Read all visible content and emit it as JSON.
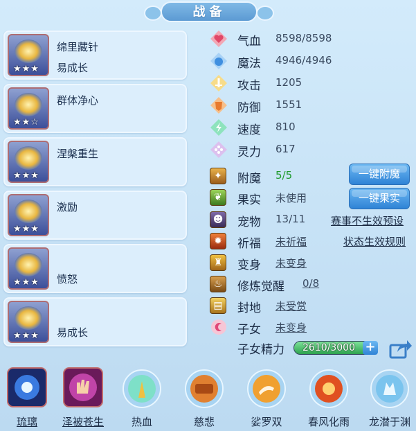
{
  "title": "战备",
  "cards": [
    {
      "name": "绵里藏针",
      "sub": "易成长",
      "stars": "★★★"
    },
    {
      "name": "群体净心",
      "sub": "",
      "stars": "★★☆"
    },
    {
      "name": "涅槃重生",
      "sub": "",
      "stars": "★★★"
    },
    {
      "name": "激励",
      "sub": "",
      "stars": "★★★"
    },
    {
      "name": "",
      "sub": "愤怒",
      "stars": "★★★"
    },
    {
      "name": "",
      "sub": "易成长",
      "stars": "★★★"
    }
  ],
  "stats": [
    {
      "label": "气血",
      "value": "8598/8598",
      "icon": "heart-icon",
      "color": "#e8607a"
    },
    {
      "label": "魔法",
      "value": "4946/4946",
      "icon": "mana-icon",
      "color": "#4ba0e8"
    },
    {
      "label": "攻击",
      "value": "1205",
      "icon": "sword-icon",
      "color": "#f0c040"
    },
    {
      "label": "防御",
      "value": "1551",
      "icon": "armor-icon",
      "color": "#f08a40"
    },
    {
      "label": "速度",
      "value": "810",
      "icon": "speed-icon",
      "color": "#30c080"
    },
    {
      "label": "灵力",
      "value": "617",
      "icon": "spirit-icon",
      "color": "#b87ed8"
    }
  ],
  "attrs": [
    {
      "label": "附魔",
      "value": "5/5",
      "icon": "enchant-icon"
    },
    {
      "label": "果实",
      "value": "未使用",
      "icon": "fruit-icon"
    },
    {
      "label": "宠物",
      "value": "13/11",
      "icon": "pet-icon"
    },
    {
      "label": "祈福",
      "value": "未祈福",
      "icon": "pray-icon"
    },
    {
      "label": "变身",
      "value": "未变身",
      "icon": "transform-icon"
    },
    {
      "label": "修炼觉醒",
      "value": "0/8",
      "icon": "cultivate-icon"
    },
    {
      "label": "封地",
      "value": "未受赏",
      "icon": "fief-icon"
    },
    {
      "label": "子女",
      "value": "未变身",
      "icon": "child-icon"
    }
  ],
  "buttons": {
    "enchant": "一键附魔",
    "fruit": "一键果实"
  },
  "links": {
    "preset": "赛事不生效预设",
    "rules": "状态生效规则"
  },
  "energy": {
    "label": "子女精力",
    "text": "2610/3000",
    "fraction": 0.87
  },
  "skills": [
    {
      "label": "琉璃",
      "icon": "crystal-orb-icon",
      "underlined": true
    },
    {
      "label": "泽被苍生",
      "icon": "healing-hand-icon",
      "underlined": true
    },
    {
      "label": "热血",
      "icon": "hot-blood-icon",
      "underlined": false
    },
    {
      "label": "慈悲",
      "icon": "mercy-scroll-icon",
      "underlined": false
    },
    {
      "label": "娑罗双",
      "icon": "sala-icon",
      "underlined": false
    },
    {
      "label": "春风化雨",
      "icon": "spring-rain-icon",
      "underlined": false
    },
    {
      "label": "龙潜于渊",
      "icon": "dragon-icon",
      "underlined": false
    }
  ]
}
